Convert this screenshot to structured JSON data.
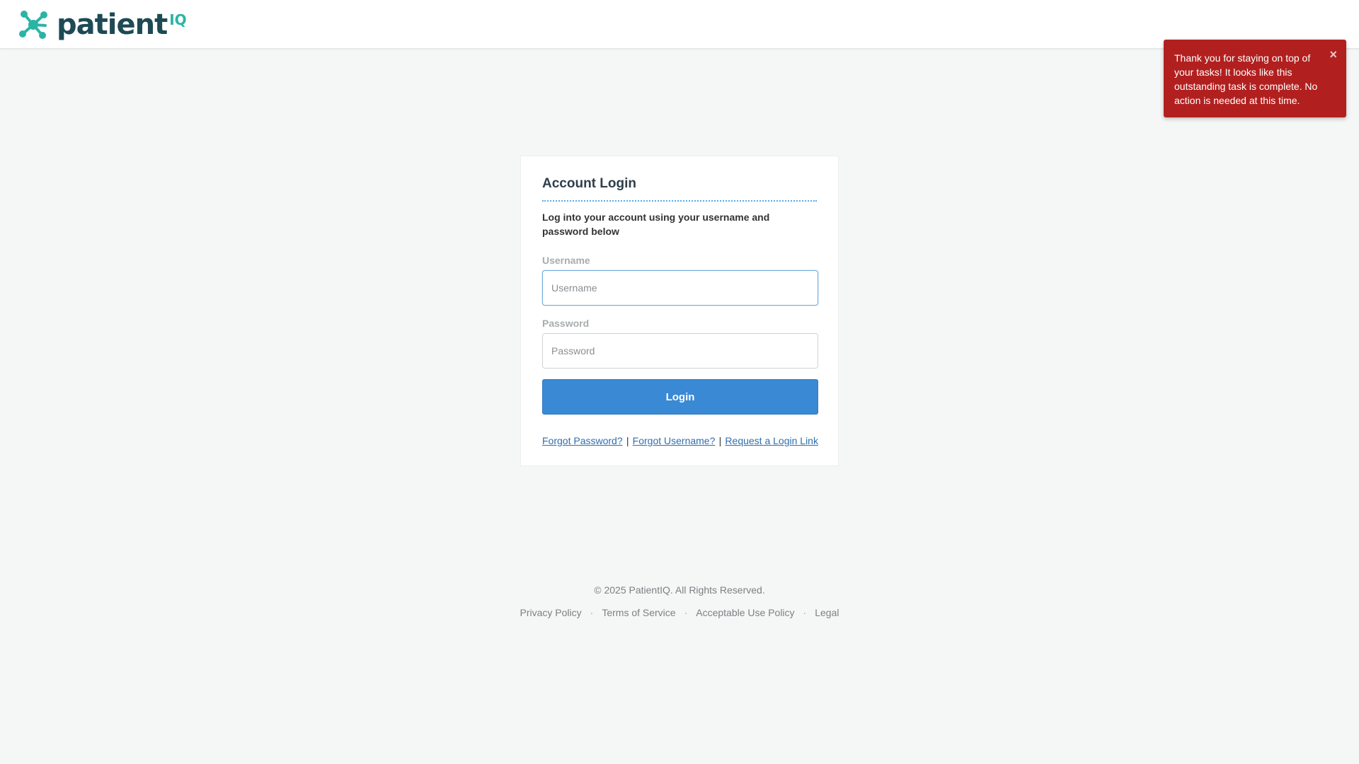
{
  "header": {
    "logo_word": "patient",
    "logo_suffix": "IQ"
  },
  "toast": {
    "message": "Thank you for staying on top of your tasks! It looks like this outstanding task is complete. No action is needed at this time.",
    "close_label": "×"
  },
  "login": {
    "title": "Account Login",
    "subtitle": "Log into your account using your username and password below",
    "username_label": "Username",
    "username_placeholder": "Username",
    "password_label": "Password",
    "password_placeholder": "Password",
    "login_button": "Login",
    "links": [
      "Forgot Password?",
      "Forgot Username?",
      "Request a Login Link"
    ],
    "separator": "|"
  },
  "footer": {
    "copyright": "© 2025 PatientIQ. All Rights Reserved.",
    "links": [
      "Privacy Policy",
      "Terms of Service",
      "Acceptable Use Policy",
      "Legal"
    ],
    "separator": "·"
  },
  "colors": {
    "brand_dark": "#1d4a55",
    "brand_teal": "#2bb4a6",
    "toast_red": "#b1201f",
    "primary_blue": "#3a89d4"
  }
}
